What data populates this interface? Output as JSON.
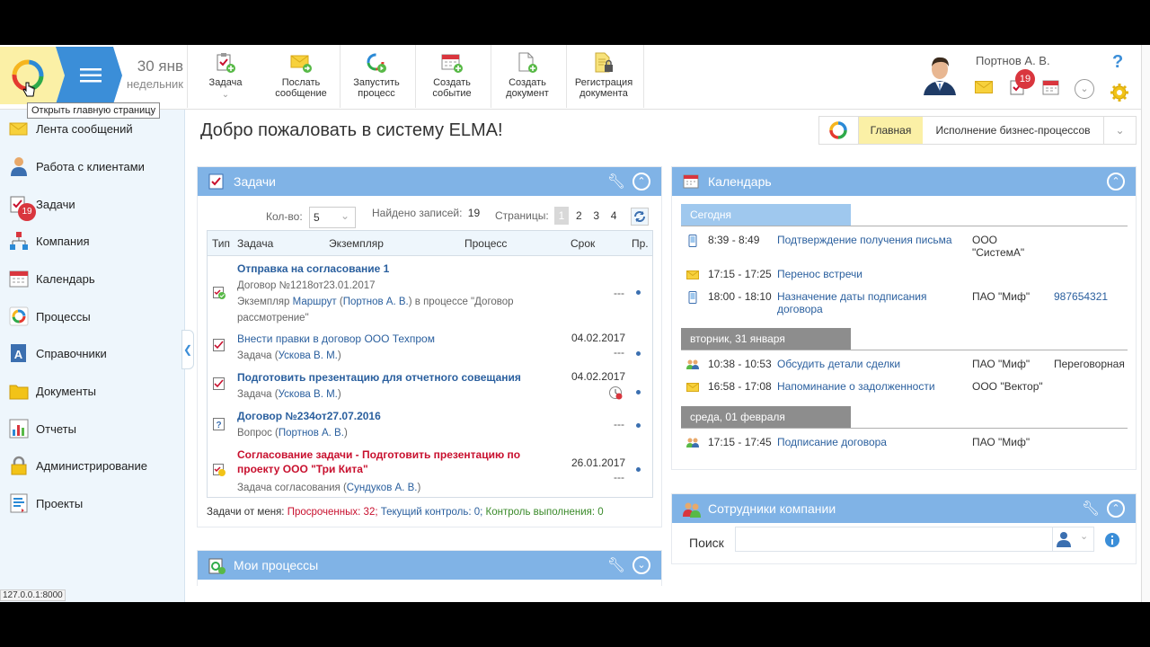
{
  "header": {
    "date_day": "30 янв",
    "date_weekday": "недельник",
    "toolbar": [
      {
        "label": "Задача",
        "icon": "task-add-icon"
      },
      {
        "label": "Послать сообщение",
        "icon": "message-send-icon"
      },
      {
        "label": "Запустить процесс",
        "icon": "process-start-icon"
      },
      {
        "label": "Создать событие",
        "icon": "event-add-icon"
      },
      {
        "label": "Создать документ",
        "icon": "document-add-icon"
      },
      {
        "label": "Регистрация документа",
        "icon": "document-register-icon"
      }
    ],
    "user_name": "Портнов А. В.",
    "task_badge": "19",
    "help": "?",
    "tooltip": "Открыть главную страницу"
  },
  "sidebar": {
    "items": [
      {
        "label": "Лента сообщений",
        "icon": "message-feed-icon"
      },
      {
        "label": "Работа с клиентами",
        "icon": "clients-icon"
      },
      {
        "label": "Задачи",
        "icon": "tasks-icon",
        "badge": "19"
      },
      {
        "label": "Компания",
        "icon": "company-icon"
      },
      {
        "label": "Календарь",
        "icon": "calendar-icon"
      },
      {
        "label": "Процессы",
        "icon": "processes-icon"
      },
      {
        "label": "Справочники",
        "icon": "directories-icon"
      },
      {
        "label": "Документы",
        "icon": "documents-icon"
      },
      {
        "label": "Отчеты",
        "icon": "reports-icon"
      },
      {
        "label": "Администрирование",
        "icon": "admin-icon"
      },
      {
        "label": "Проекты",
        "icon": "projects-icon"
      }
    ],
    "status_url": "127.0.0.1:8000"
  },
  "main": {
    "title": "Добро пожаловать в систему ELMA!",
    "view_tabs": [
      "Главная",
      "Исполнение бизнес-процессов"
    ]
  },
  "tasks": {
    "title": "Задачи",
    "count_label": "Кол-во:",
    "count_value": "5",
    "found_label": "Найдено записей:",
    "found_value": "19",
    "pages_label": "Страницы:",
    "pages": [
      "1",
      "2",
      "3",
      "4"
    ],
    "columns": [
      "Тип",
      "Задача",
      "Экземпляр",
      "Процесс",
      "Срок",
      "Пр."
    ],
    "rows": [
      {
        "title": "Отправка на согласование 1",
        "sub1": "Договор №1218от23.01.2017",
        "sub2_pre": "Экземпляр ",
        "sub2_link": "Маршрут",
        "sub2_mid": " (",
        "sub2_person": "Портнов А. В.",
        "sub2_post": ") в процессе \"Договор рассмотрение\"",
        "date": "",
        "dash": "---"
      },
      {
        "title": "Внести правки в договор ООО Техпром",
        "sub_pre": "Задача (",
        "sub_person": "Ускова В. М.",
        "sub_post": ")",
        "date": "04.02.2017",
        "dash": "---"
      },
      {
        "title": "Подготовить презентацию для отчетного совещания",
        "sub_pre": "Задача (",
        "sub_person": "Ускова В. М.",
        "sub_post": ")",
        "date": "04.02.2017",
        "dash": ""
      },
      {
        "title": "Договор №234от27.07.2016",
        "sub_pre": "Вопрос (",
        "sub_person": "Портнов А. В.",
        "sub_post": ")",
        "date": "",
        "dash": "---"
      },
      {
        "title": "Согласование задачи - Подготовить презентацию по проекту ООО \"Три Кита\"",
        "sub_pre": "Задача согласования (",
        "sub_person": "Сундуков А. В.",
        "sub_post": ")",
        "date": "26.01.2017",
        "dash": "---"
      }
    ],
    "footer_label": "Задачи от меня:",
    "footer_overdue": "Просроченных: 32;",
    "footer_current": "Текущий контроль: 0;",
    "footer_control": "Контроль выполнения: 0"
  },
  "processes": {
    "title": "Мои процессы"
  },
  "calendar": {
    "title": "Календарь",
    "days": [
      {
        "label": "Сегодня",
        "events": [
          {
            "time": "8:39 - 8:49",
            "subject": "Подтверждение получения письма",
            "org": "ООО \"СистемА\"",
            "extra": ""
          },
          {
            "time": "17:15 - 17:25",
            "subject": "Перенос встречи",
            "org": "",
            "extra": ""
          },
          {
            "time": "18:00 - 18:10",
            "subject": "Назначение даты подписания договора",
            "org": "ПАО \"Миф\"",
            "extra": "987654321"
          }
        ]
      },
      {
        "label": "вторник, 31 января",
        "events": [
          {
            "time": "10:38 - 10:53",
            "subject": "Обсудить детали сделки",
            "org": "ПАО \"Миф\"",
            "extra": "Переговорная"
          },
          {
            "time": "16:58 - 17:08",
            "subject": "Напоминание о задолженности",
            "org": "ООО \"Вектор\"",
            "extra": ""
          }
        ]
      },
      {
        "label": "среда, 01 февраля",
        "events": [
          {
            "time": "17:15 - 17:45",
            "subject": "Подписание договора",
            "org": "ПАО \"Миф\"",
            "extra": ""
          }
        ]
      }
    ]
  },
  "employees": {
    "title": "Сотрудники компании",
    "search_label": "Поиск",
    "search_value": ""
  },
  "colors": {
    "accent_blue": "#3b8ed8",
    "portlet_head": "#80b3e6",
    "highlight_yellow": "#fbf0a6",
    "overdue_red": "#c8102e",
    "control_green": "#3a8a2a"
  }
}
